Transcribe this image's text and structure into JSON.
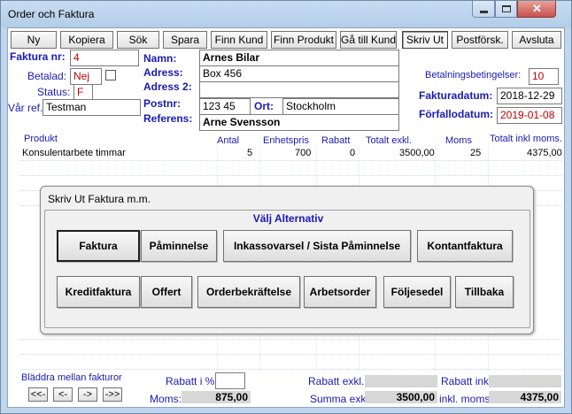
{
  "window": {
    "title": "Order och Faktura"
  },
  "toolbar": [
    {
      "label": "Ny"
    },
    {
      "label": "Kopiera"
    },
    {
      "label": "Sök"
    },
    {
      "label": "Spara"
    },
    {
      "label": "Finn Kund"
    },
    {
      "label": "Finn Produkt"
    },
    {
      "label": "Gå till Kund"
    },
    {
      "label": "Skriv Ut"
    },
    {
      "label": "Postförsk."
    },
    {
      "label": "Avsluta"
    }
  ],
  "invoice": {
    "faktura_nr_label": "Faktura nr:",
    "faktura_nr": "4",
    "betalad_label": "Betalad:",
    "betalad": "Nej",
    "status_label": "Status:",
    "status": "F",
    "var_ref_label": "Vår ref.:",
    "var_ref": "Testman"
  },
  "customer": {
    "namn_label": "Namn:",
    "namn": "Arnes Bilar",
    "adress_label": "Adress:",
    "adress": "Box 456",
    "adress2_label": "Adress 2:",
    "adress2": "",
    "postnr_label": "Postnr:",
    "postnr": "123 45",
    "ort_label": "Ort:",
    "ort": "Stockholm",
    "referens_label": "Referens:",
    "referens": "Arne Svensson"
  },
  "terms": {
    "betalningsvillkor_label": "Betalningsbetingelser:",
    "betalningsvillkor": "10",
    "fakturadatum_label": "Fakturadatum:",
    "fakturadatum": "2018-12-29",
    "forfallodatum_label": "Förfallodatum:",
    "forfallodatum": "2019-01-08"
  },
  "grid": {
    "headers": {
      "produkt": "Produkt",
      "antal": "Antal",
      "enhetspris": "Enhetspris",
      "rabatt": "Rabatt",
      "totalt_exkl": "Totalt exkl.",
      "moms": "Moms",
      "totalt_inkl": "Totalt inkl moms."
    },
    "rows": [
      {
        "produkt": "Konsulentarbete timmar",
        "antal": "5",
        "enhetspris": "700",
        "rabatt": "0",
        "totalt_exkl": "3500,00",
        "moms": "25",
        "totalt_inkl": "4375,00"
      }
    ]
  },
  "dialog": {
    "title": "Skriv Ut Faktura m.m.",
    "group_title": "Välj Alternativ",
    "row1": [
      {
        "label": "Faktura"
      },
      {
        "label": "Påminnelse"
      },
      {
        "label": "Inkassovarsel / Sista Påminnelse"
      },
      {
        "label": "Kontantfaktura"
      }
    ],
    "row2": [
      {
        "label": "Kreditfaktura"
      },
      {
        "label": "Offert"
      },
      {
        "label": "Orderbekräftelse"
      },
      {
        "label": "Arbetsorder"
      },
      {
        "label": "Följesedel"
      },
      {
        "label": "Tillbaka"
      }
    ]
  },
  "footer": {
    "browse_label": "Bläddra mellan fakturor",
    "nav": [
      "<<-",
      "<-",
      "->",
      "->>"
    ],
    "rabatt_pct_label": "Rabatt i %:",
    "rabatt_pct": "",
    "moms_label": "Moms:",
    "moms": "875,00",
    "rabatt_exkl_label": "Rabatt exkl.",
    "rabatt_exkl": "",
    "summa_exkl_label": "Summa exkl.",
    "summa_exkl": "3500,00",
    "rabatt_inkl_label": "Rabatt inkl.",
    "rabatt_inkl": "",
    "inkl_moms_label": "inkl. moms:",
    "inkl_moms": "4375,00"
  },
  "colors": {
    "label_blue": "#1a1ab4",
    "value_red": "#c00000"
  }
}
